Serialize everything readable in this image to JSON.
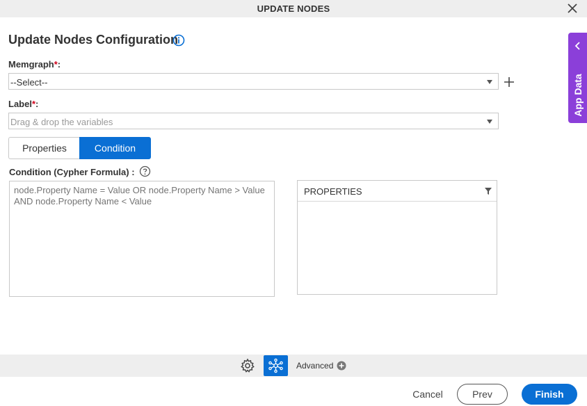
{
  "window": {
    "title": "UPDATE NODES"
  },
  "header": {
    "title": "Update Nodes Configuration"
  },
  "memgraph": {
    "label": "Memgraph",
    "required_mark": "*",
    "suffix": ":",
    "value": "--Select--"
  },
  "label_field": {
    "label": "Label",
    "required_mark": "*",
    "suffix": ":",
    "placeholder": "Drag & drop the variables"
  },
  "tabs": [
    {
      "label": "Properties",
      "active": false
    },
    {
      "label": "Condition",
      "active": true
    }
  ],
  "condition": {
    "label": "Condition (Cypher Formula) :",
    "placeholder": "node.Property Name = Value OR node.Property Name > Value AND node.Property Name < Value"
  },
  "properties_panel": {
    "header": "PROPERTIES"
  },
  "side_panel": {
    "label": "App Data"
  },
  "bottom_toolbar": {
    "advanced_label": "Advanced"
  },
  "footer": {
    "cancel_label": "Cancel",
    "prev_label": "Prev",
    "finish_label": "Finish"
  },
  "colors": {
    "accent": "#0a6fd4",
    "side_tab": "#8b3fd9",
    "required": "#d0021b"
  }
}
